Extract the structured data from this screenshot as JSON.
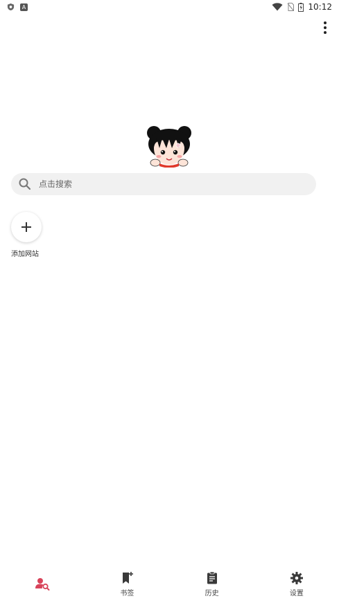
{
  "status_bar": {
    "left_icons": [
      "shield-icon",
      "app-a-icon"
    ],
    "app_badge": "A",
    "right_icons": [
      "wifi-icon",
      "no-sim-icon",
      "battery-icon"
    ],
    "time": "10:12"
  },
  "toolbar": {
    "menu_icon": "more-vert-icon"
  },
  "logo": {
    "icon": "cartoon-girl-logo"
  },
  "search": {
    "placeholder": "点击搜索",
    "value": ""
  },
  "shortcuts": {
    "add_site_label": "添加网站",
    "add_site_icon": "plus-icon"
  },
  "bottom_nav": {
    "items": [
      {
        "label": "",
        "icon": "user-search-icon",
        "active": true
      },
      {
        "label": "书签",
        "icon": "bookmark-icon",
        "active": false
      },
      {
        "label": "历史",
        "icon": "history-icon",
        "active": false
      },
      {
        "label": "设置",
        "icon": "settings-icon",
        "active": false
      }
    ]
  },
  "colors": {
    "accent": "#d8435a",
    "icon": "#3a3a3a",
    "search_bg": "#f1f1f1"
  }
}
